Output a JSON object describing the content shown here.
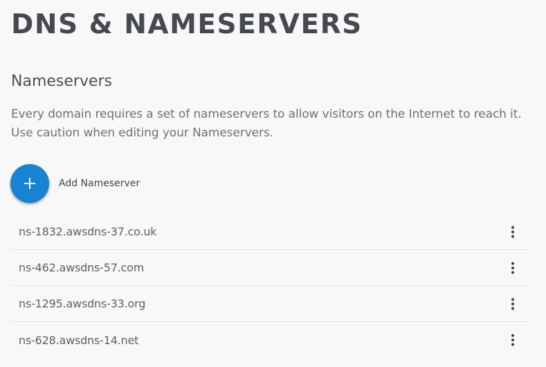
{
  "header": {
    "title": "DNS & NAMESERVERS"
  },
  "nameservers_section": {
    "title": "Nameservers",
    "description": "Every domain requires a set of nameservers to allow visitors on the Internet to reach it. Use caution when editing your Nameservers.",
    "add_button": {
      "icon": "plus-icon",
      "label": "Add Nameserver",
      "color": "#1783d2"
    },
    "nameservers": [
      {
        "name": "ns-1832.awsdns-37.co.uk",
        "menu_icon": "more-vertical-icon"
      },
      {
        "name": "ns-462.awsdns-57.com",
        "menu_icon": "more-vertical-icon"
      },
      {
        "name": "ns-1295.awsdns-33.org",
        "menu_icon": "more-vertical-icon"
      },
      {
        "name": "ns-628.awsdns-14.net",
        "menu_icon": "more-vertical-icon"
      }
    ]
  }
}
